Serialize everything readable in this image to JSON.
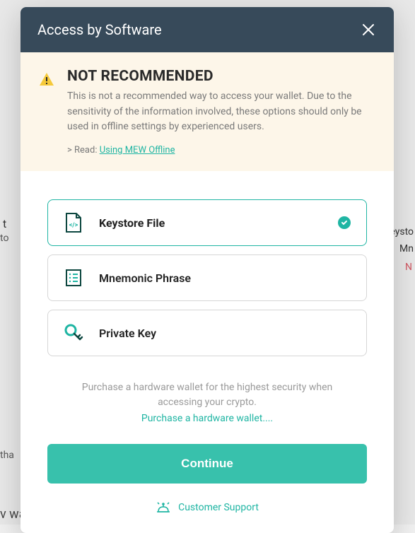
{
  "modal": {
    "title": "Access by Software"
  },
  "warning": {
    "heading": "NOT RECOMMENDED",
    "body": "This is not a recommended way to access your wallet. Due to the sensitivity of the information involved, these options should only be used in offline settings by experienced users.",
    "read_prefix": "> Read: ",
    "read_link": "Using MEW Offline"
  },
  "options": [
    {
      "label": "Keystore File",
      "selected": true
    },
    {
      "label": "Mnemonic Phrase",
      "selected": false
    },
    {
      "label": "Private Key",
      "selected": false
    }
  ],
  "purchase": {
    "text": "Purchase a hardware wallet for the highest security when accessing your crypto.",
    "link": "Purchase a hardware wallet...."
  },
  "continue_label": "Continue",
  "support_label": "Customer Support",
  "background": {
    "t1": "t",
    "t2": "to",
    "t3": "tha",
    "t4": "v wallet?",
    "t5": "Keysto",
    "t6": "Mn",
    "t7": "N"
  }
}
